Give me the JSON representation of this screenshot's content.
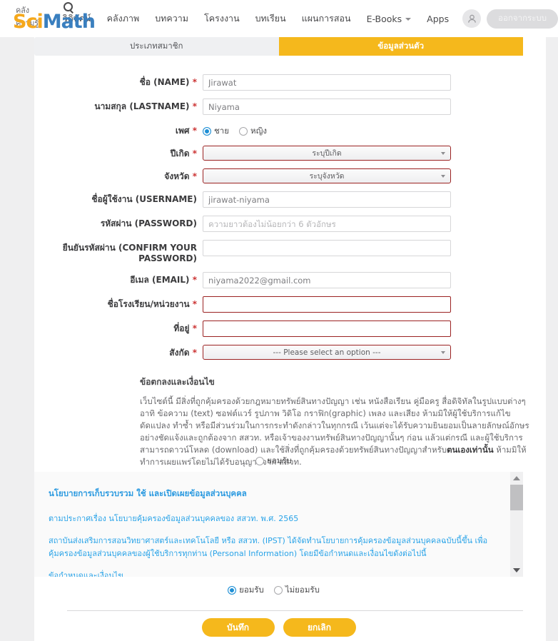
{
  "header": {
    "logo": {
      "tagline": "คลังความรู้",
      "name_part1": "Sci",
      "name_part2": "Math",
      "search_icon": "search-icon"
    },
    "nav": [
      {
        "label": "วิดิทัศน์",
        "has_caret": false
      },
      {
        "label": "คลังภาพ",
        "has_caret": false
      },
      {
        "label": "บทความ",
        "has_caret": false
      },
      {
        "label": "โครงงาน",
        "has_caret": false
      },
      {
        "label": "บทเรียน",
        "has_caret": false
      },
      {
        "label": "แผนการสอน",
        "has_caret": false
      },
      {
        "label": "E-Books",
        "has_caret": true
      },
      {
        "label": "Apps",
        "has_caret": false
      }
    ],
    "logout_label": "ออกจากระบบ",
    "avatar_icon": "user-icon"
  },
  "tabs": [
    {
      "label": "ประเภทสมาชิก",
      "active": false
    },
    {
      "label": "ข้อมูลส่วนตัว",
      "active": true
    }
  ],
  "form": {
    "name": {
      "label": "ชื่อ (NAME)",
      "required": true,
      "value": "Jirawat"
    },
    "lastname": {
      "label": "นามสกุล (LASTNAME)",
      "required": true,
      "value": "Niyama"
    },
    "gender": {
      "label": "เพศ",
      "required": true,
      "options": [
        {
          "label": "ชาย",
          "selected": true
        },
        {
          "label": "หญิง",
          "selected": false
        }
      ]
    },
    "birthyear": {
      "label": "ปีเกิด",
      "required": true,
      "value": "ระบุปีเกิด",
      "error": true
    },
    "province": {
      "label": "จังหวัด",
      "required": true,
      "value": "ระบุจังหวัด",
      "error": true
    },
    "username": {
      "label": "ชื่อผู้ใช้งาน (USERNAME)",
      "required": false,
      "value": "jirawat-niyama"
    },
    "password": {
      "label": "รหัสผ่าน (PASSWORD)",
      "required": false,
      "value": "",
      "placeholder": "ความยาวต้องไม่น้อยกว่า 6 ตัวอักษร"
    },
    "confirm_password": {
      "label": "ยืนยันรหัสผ่าน (CONFIRM YOUR PASSWORD)",
      "required": false,
      "value": "",
      "placeholder": ""
    },
    "email": {
      "label": "อีเมล (EMAIL)",
      "required": true,
      "value": "niyama2022@gmail.com"
    },
    "school": {
      "label": "ชื่อโรงเรียน/หน่วยงาน",
      "required": true,
      "value": "",
      "placeholder": "",
      "error": true
    },
    "address": {
      "label": "ที่อยู่",
      "required": true,
      "value": "",
      "placeholder": "",
      "error": true
    },
    "affiliation": {
      "label": "สังกัด",
      "required": true,
      "value": "--- Please select an option ---",
      "error": true
    }
  },
  "terms": {
    "heading": "ข้อตกลงและเงื่อนไข",
    "body_part1": "เว็บไซต์นี้ มีสิ่งที่ถูกคุ้มครองด้วยกฎหมายทรัพย์สินทางปัญญา เช่น หนังสือเรียน คู่มือครู สื่อดิจิทัลในรูปแบบต่างๆ อาทิ ข้อความ (text) ซอฟต์แวร์ รูปภาพ วิดิโอ กราฟิก(graphic) เพลง และเสียง ห้ามมิให้ผู้ใช้บริการแก้ไข ดัดแปลง ทำซ้ำ หรือมีส่วนร่วมในการกระทำดังกล่าวในทุกกรณี เว้นแต่จะได้รับความยินยอมเป็นลายลักษณ์อักษรอย่างชัดแจ้งและถูกต้องจาก สสวท. หรือเจ้าของงานทรัพย์สินทางปัญญานั้นๆ ก่อน แล้วแต่กรณี และผู้ใช้บริการสามารถดาวน์โหลด (download) และใช้สิ่งที่ถูกคุ้มครองด้วยทรัพย์สินทางปัญญาสำหรับ",
    "body_bold": "ตนเองเท่านั้น",
    "body_part2": " ห้ามมิให้ทำการเผยแพร่โดยไม่ได้รับอนุญาตจาก สสวท.",
    "accept_label": "ยอมรับ",
    "accept_selected": false
  },
  "policy": {
    "title": "นโยบายการเก็บรวบรวม ใช้ และเปิดเผยข้อมูลส่วนบุคคล",
    "paragraph1": "ตามประกาศเรื่อง นโยบายคุ้มครองข้อมูลส่วนบุคคลของ สสวท. พ.ศ. 2565",
    "paragraph2": "สถาบันส่งเสริมการสอนวิทยาศาสตร์และเทคโนโลยี หรือ สสวท. (IPST) ได้จัดทำนโยบายการคุ้มครองข้อมูลส่วนบุคคลฉบับนี้ขึ้น เพื่อคุ้มครองข้อมูลส่วนบุคคลของผู้ใช้บริการทุกท่าน (Personal Information) โดยมีข้อกำหนดและเงื่อนไขดังต่อไปนี้",
    "paragraph3": "ข้อกำหนดและเงื่อนไข",
    "scroll_up_icon": "scroll-up-arrow-icon",
    "scroll_down_icon": "scroll-down-arrow-icon"
  },
  "consent": {
    "options": [
      {
        "label": "ยอมรับ",
        "selected": true
      },
      {
        "label": "ไม่ยอมรับ",
        "selected": false
      }
    ]
  },
  "actions": {
    "save_label": "บันทึก",
    "cancel_label": "ยกเลิก"
  },
  "colors": {
    "accent_orange": "#f5b81c",
    "logo_blue": "#3a7fbf",
    "policy_blue": "#29a3e8",
    "error_red": "#9b2222",
    "radio_blue": "#1e8fd5"
  }
}
